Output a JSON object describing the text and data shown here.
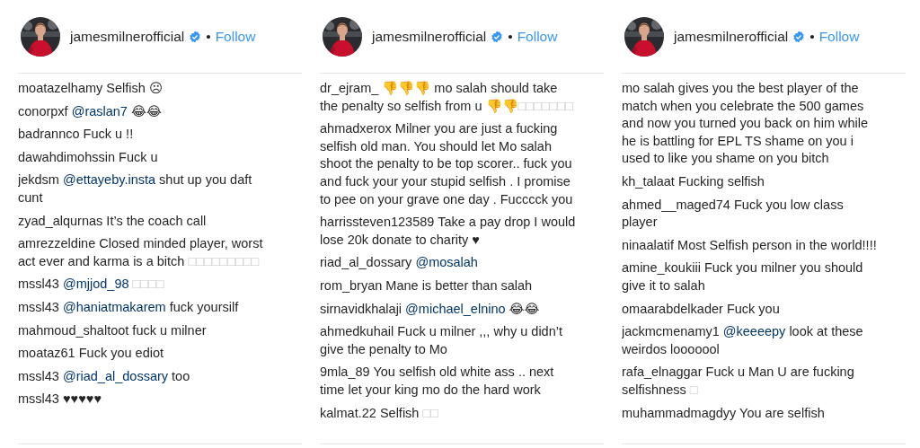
{
  "panels": [
    {
      "header": {
        "username": "jamesmilnerofficial",
        "verified": true,
        "separator": "•",
        "follow": "Follow"
      },
      "comments": [
        {
          "user": "moatazelhamy",
          "segments": [
            {
              "kind": "text",
              "text": "Selfish ☹"
            }
          ]
        },
        {
          "user": "conorpxf",
          "segments": [
            {
              "kind": "mention",
              "text": "@raslan7"
            },
            {
              "kind": "text",
              "text": " 😂😂"
            }
          ]
        },
        {
          "user": "badrannco",
          "segments": [
            {
              "kind": "text",
              "text": "Fuck u !!"
            }
          ]
        },
        {
          "user": "dawahdimohssin",
          "segments": [
            {
              "kind": "text",
              "text": "Fuck u"
            }
          ]
        },
        {
          "user": "jekdsm",
          "segments": [
            {
              "kind": "mention",
              "text": "@ettayeby.insta"
            },
            {
              "kind": "text",
              "text": " shut up you daft cunt"
            }
          ]
        },
        {
          "user": "zyad_alqurnas",
          "segments": [
            {
              "kind": "text",
              "text": "It’s the coach call"
            }
          ]
        },
        {
          "user": "amrezzeldine",
          "segments": [
            {
              "kind": "text",
              "text": "Closed minded player, worst act ever and karma is a bitch "
            },
            {
              "kind": "missing",
              "text": "□□□□□□□□□"
            }
          ]
        },
        {
          "user": "mssl43",
          "segments": [
            {
              "kind": "mention",
              "text": "@mjjod_98"
            },
            {
              "kind": "missing",
              "text": " □□□□"
            }
          ]
        },
        {
          "user": "mssl43",
          "segments": [
            {
              "kind": "mention",
              "text": "@haniatmakarem"
            },
            {
              "kind": "text",
              "text": " fuck yoursilf"
            }
          ]
        },
        {
          "user": "mahmoud_shaltoot",
          "segments": [
            {
              "kind": "text",
              "text": "fuck u milner"
            }
          ]
        },
        {
          "user": "moataz61",
          "segments": [
            {
              "kind": "text",
              "text": "Fuck you ediot"
            }
          ]
        },
        {
          "user": "mssl43",
          "segments": [
            {
              "kind": "mention",
              "text": "@riad_al_dossary"
            },
            {
              "kind": "text",
              "text": " too"
            }
          ]
        },
        {
          "user": "mssl43",
          "segments": [
            {
              "kind": "text",
              "text": "♥♥♥♥♥"
            }
          ]
        }
      ]
    },
    {
      "header": {
        "username": "jamesmilnerofficial",
        "verified": true,
        "separator": "•",
        "follow": "Follow"
      },
      "comments": [
        {
          "user": "dr_ejram_",
          "segments": [
            {
              "kind": "text",
              "text": "👎👎👎 mo salah should take the penalty so selfish from u 👎👎"
            },
            {
              "kind": "missing",
              "text": "□□□□□□□"
            }
          ]
        },
        {
          "user": "ahmadxerox",
          "segments": [
            {
              "kind": "text",
              "text": "Milner you are just a fucking selfish old man. You should let Mo salah shoot the penalty to be top scorer.. fuck you and fuck your your stupid selfish . I promise to pee on your grave one day . Fucccck you"
            }
          ]
        },
        {
          "user": "harrissteven123589",
          "segments": [
            {
              "kind": "text",
              "text": "Take a pay drop I would lose 20k donate to charity ♥"
            }
          ]
        },
        {
          "user": "riad_al_dossary",
          "segments": [
            {
              "kind": "mention",
              "text": "@mosalah"
            }
          ]
        },
        {
          "user": "rom_bryan",
          "segments": [
            {
              "kind": "text",
              "text": "Mane is better than salah"
            }
          ]
        },
        {
          "user": "sirnavidkhalaji",
          "segments": [
            {
              "kind": "mention",
              "text": "@michael_elnino"
            },
            {
              "kind": "text",
              "text": " 😂😂"
            }
          ]
        },
        {
          "user": "ahmedkuhail",
          "segments": [
            {
              "kind": "text",
              "text": "Fuck u milner ,,, why u didn’t give the penalty to Mo"
            }
          ]
        },
        {
          "user": "9mla_89",
          "segments": [
            {
              "kind": "text",
              "text": "You selfish old white ass .. next time let your king mo do the hard work"
            }
          ]
        },
        {
          "user": "kalmat.22",
          "segments": [
            {
              "kind": "text",
              "text": "Selfish "
            },
            {
              "kind": "missing",
              "text": "□□"
            }
          ]
        }
      ]
    },
    {
      "header": {
        "username": "jamesmilnerofficial",
        "verified": true,
        "separator": "•",
        "follow": "Follow"
      },
      "comments": [
        {
          "segments": [
            {
              "kind": "text",
              "text": "mo salah gives you the best player of the match when you celebrate the 500 games and now you turned you back on him while he is battling for EPL TS shame on you i used to like you shame on you bitch"
            }
          ]
        },
        {
          "user": "kh_talaat",
          "segments": [
            {
              "kind": "text",
              "text": "Fucking selfish"
            }
          ]
        },
        {
          "user": "ahmed__maged74",
          "segments": [
            {
              "kind": "text",
              "text": "Fuck you low class player"
            }
          ]
        },
        {
          "user": "ninaalatif",
          "segments": [
            {
              "kind": "text",
              "text": "Most Selfish person in the world!!!!"
            }
          ]
        },
        {
          "user": "amine_koukiii",
          "segments": [
            {
              "kind": "text",
              "text": "Fuck you milner you should give it to salah"
            }
          ]
        },
        {
          "user": "omaarabdelkader",
          "segments": [
            {
              "kind": "text",
              "text": "Fuck you"
            }
          ]
        },
        {
          "user": "jackmcmenamy1",
          "segments": [
            {
              "kind": "mention",
              "text": "@keeeepy"
            },
            {
              "kind": "text",
              "text": " look at these weirdos looooool"
            }
          ]
        },
        {
          "user": "rafa_elnaggar",
          "segments": [
            {
              "kind": "text",
              "text": "Fuck u Man U are fucking selfishness "
            },
            {
              "kind": "missing",
              "text": "□"
            }
          ]
        },
        {
          "user": "muhammadmagdyy",
          "segments": [
            {
              "kind": "text",
              "text": "You are selfish"
            }
          ]
        }
      ]
    }
  ]
}
